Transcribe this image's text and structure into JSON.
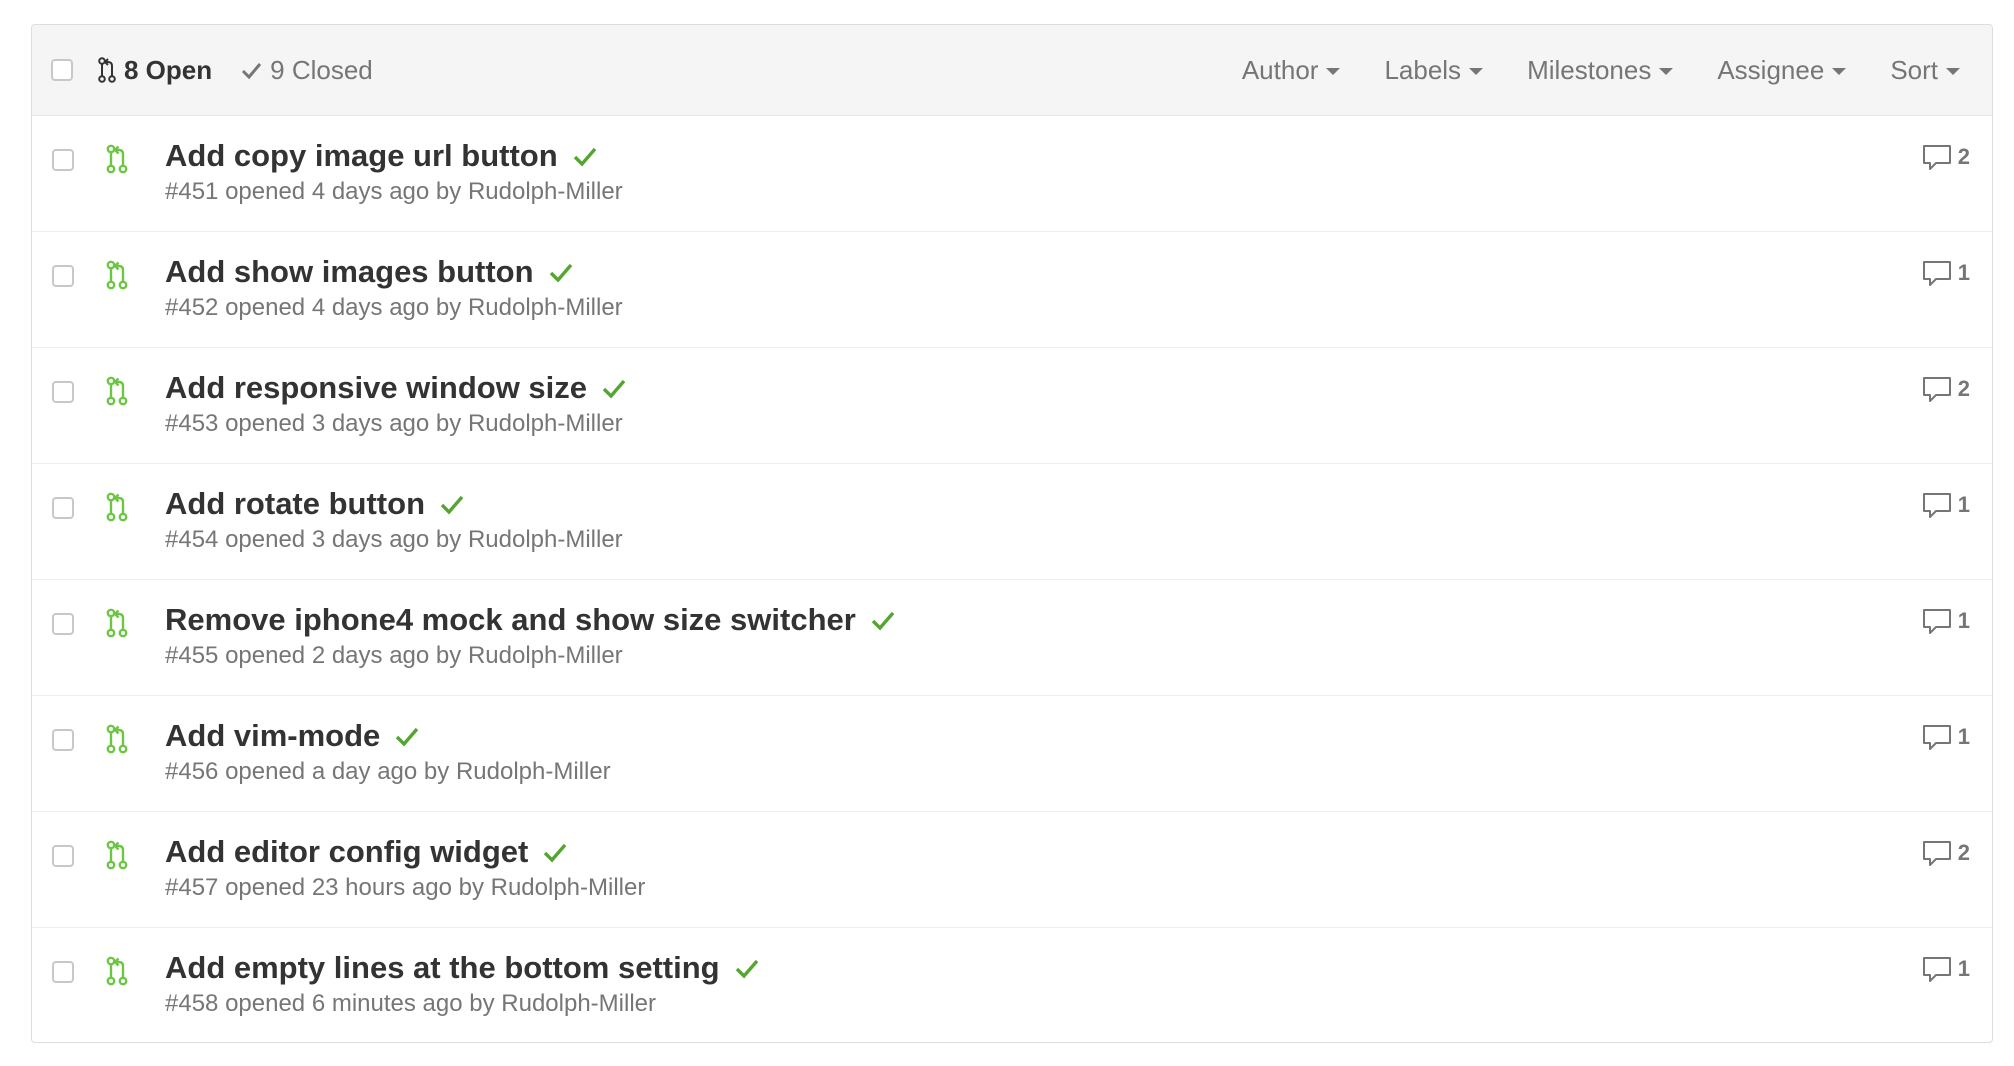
{
  "header": {
    "open_count": "8 Open",
    "closed_count": "9 Closed",
    "filters": [
      {
        "label": "Author"
      },
      {
        "label": "Labels"
      },
      {
        "label": "Milestones"
      },
      {
        "label": "Assignee"
      },
      {
        "label": "Sort"
      }
    ]
  },
  "colors": {
    "open_icon": "#6cc644",
    "status_success": "#55a532",
    "muted_text": "#767676"
  },
  "icons": {
    "pull_request": "git-pull-request-icon",
    "status": "check-icon",
    "comment": "comment-icon"
  },
  "pull_requests": [
    {
      "title": "Add copy image url button",
      "number": "#451",
      "opened": "opened 4 days ago by",
      "author": "Rudolph-Miller",
      "comments": "2"
    },
    {
      "title": "Add show images button",
      "number": "#452",
      "opened": "opened 4 days ago by",
      "author": "Rudolph-Miller",
      "comments": "1"
    },
    {
      "title": "Add responsive window size",
      "number": "#453",
      "opened": "opened 3 days ago by",
      "author": "Rudolph-Miller",
      "comments": "2"
    },
    {
      "title": "Add rotate button",
      "number": "#454",
      "opened": "opened 3 days ago by",
      "author": "Rudolph-Miller",
      "comments": "1"
    },
    {
      "title": "Remove iphone4 mock and show size switcher",
      "number": "#455",
      "opened": "opened 2 days ago by",
      "author": "Rudolph-Miller",
      "comments": "1"
    },
    {
      "title": "Add vim-mode",
      "number": "#456",
      "opened": "opened a day ago by",
      "author": "Rudolph-Miller",
      "comments": "1"
    },
    {
      "title": "Add editor config widget",
      "number": "#457",
      "opened": "opened 23 hours ago by",
      "author": "Rudolph-Miller",
      "comments": "2"
    },
    {
      "title": "Add empty lines at the bottom setting",
      "number": "#458",
      "opened": "opened 6 minutes ago by",
      "author": "Rudolph-Miller",
      "comments": "1"
    }
  ]
}
